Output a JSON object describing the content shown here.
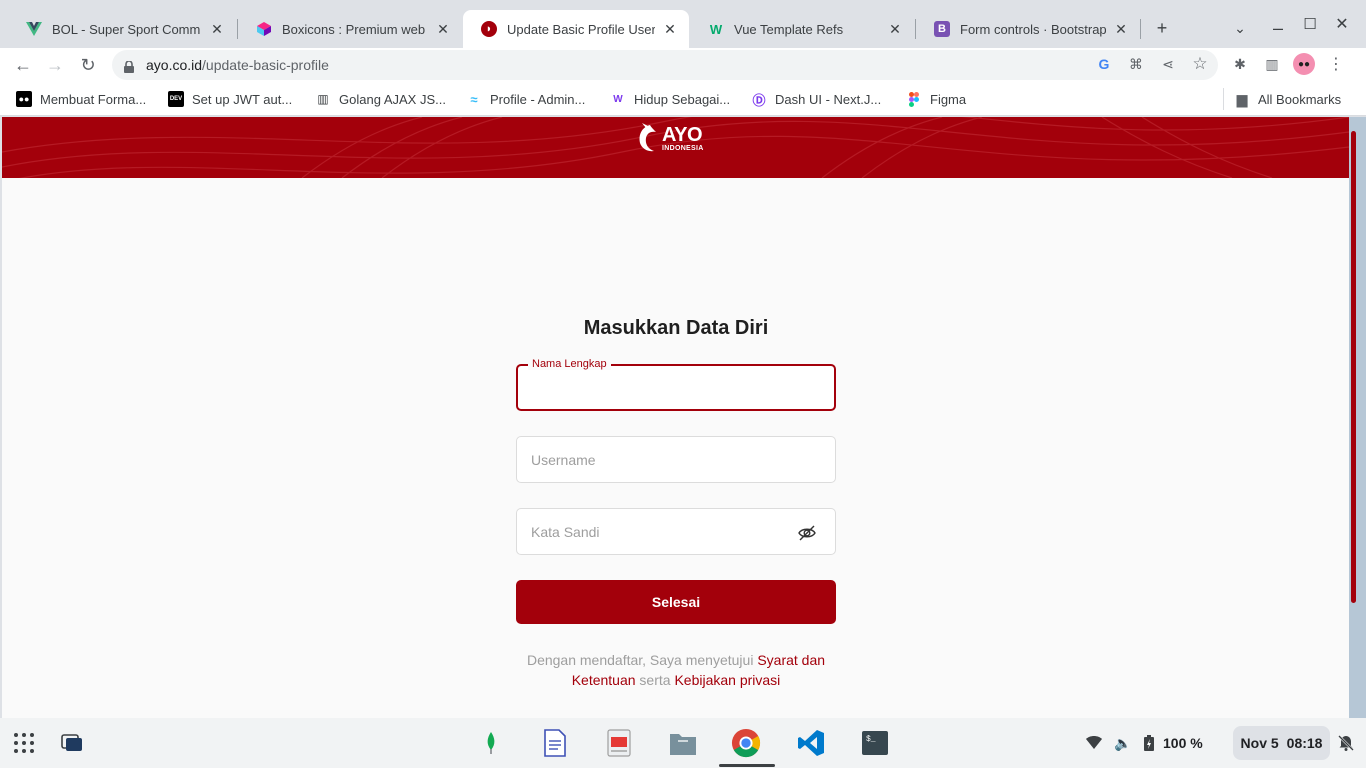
{
  "browser": {
    "tabs": [
      {
        "title": "BOL - Super Sport Comm",
        "icon": "vue-icon",
        "active": false
      },
      {
        "title": "Boxicons : Premium web f",
        "icon": "boxicons-icon",
        "active": false
      },
      {
        "title": "Update Basic Profile User",
        "icon": "ayo-icon",
        "active": true
      },
      {
        "title": "Vue Template Refs",
        "icon": "w3-icon",
        "active": false
      },
      {
        "title": "Form controls · Bootstrap",
        "icon": "bootstrap-icon",
        "active": false
      }
    ],
    "new_tab": "+",
    "url_domain": "ayo.co.id",
    "url_path": "/update-basic-profile",
    "bookmarks": [
      {
        "label": "Membuat Forma...",
        "icon": "medium-icon"
      },
      {
        "label": "Set up JWT aut...",
        "icon": "dev-icon"
      },
      {
        "label": "Golang AJAX JS...",
        "icon": "book-icon"
      },
      {
        "label": "Profile - Admin...",
        "icon": "tailwind-icon"
      },
      {
        "label": "Hidup Sebagai...",
        "icon": "w-icon"
      },
      {
        "label": "Dash UI - Next.J...",
        "icon": "dashui-icon"
      },
      {
        "label": "Figma",
        "icon": "figma-icon"
      }
    ],
    "all_bookmarks": "All Bookmarks"
  },
  "header": {
    "logo_main": "AYO",
    "logo_sub": "INDONESIA"
  },
  "form": {
    "title": "Masukkan Data Diri",
    "name_label": "Nama Lengkap",
    "name_value": "",
    "username_placeholder": "Username",
    "password_placeholder": "Kata Sandi",
    "submit_label": "Selesai",
    "terms_prefix": "Dengan mendaftar, Saya menyetujui ",
    "terms_link": "Syarat dan Ketentuan",
    "terms_middle": " serta ",
    "privacy_link": "Kebijakan privasi"
  },
  "shelf": {
    "battery": "100 %",
    "date": "Nov 5",
    "time": "08:18"
  },
  "colors": {
    "brand": "#a3000b"
  }
}
